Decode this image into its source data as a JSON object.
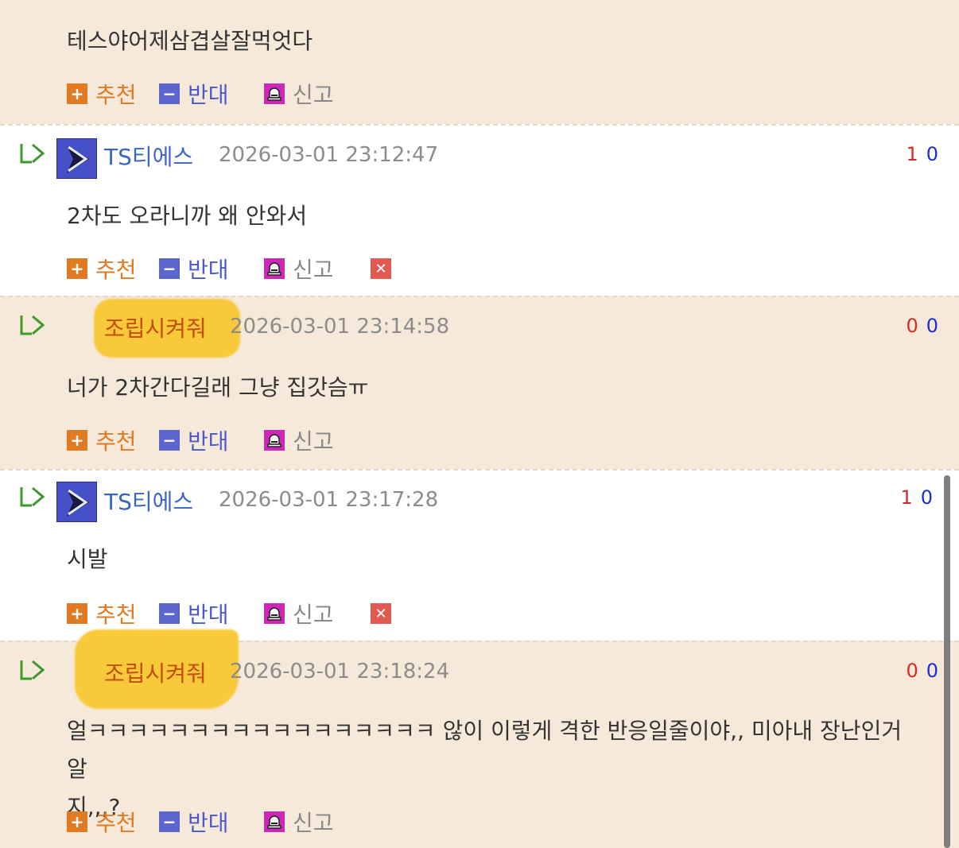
{
  "top_comment": {
    "content": "테스야어제삼겹살잘먹엇다",
    "actions": {
      "recommend": "추천",
      "oppose": "반대",
      "report": "신고"
    }
  },
  "comments": [
    {
      "nickname": "TS티에스",
      "timestamp": "2026-03-01 23:12:47",
      "votes_up": "1",
      "votes_down": "0",
      "content": "2차도 오라니까 왜 안와서",
      "actions": {
        "recommend": "추천",
        "oppose": "반대",
        "report": "신고"
      }
    },
    {
      "nickname": "조립시켜줘",
      "timestamp": "2026-03-01 23:14:58",
      "votes_up": "0",
      "votes_down": "0",
      "content": "너가 2차간다길래 그냥 집갓슴ㅠ",
      "actions": {
        "recommend": "추천",
        "oppose": "반대",
        "report": "신고"
      }
    },
    {
      "nickname": "TS티에스",
      "timestamp": "2026-03-01 23:17:28",
      "votes_up": "1",
      "votes_down": "0",
      "content": "시발",
      "actions": {
        "recommend": "추천",
        "oppose": "반대",
        "report": "신고"
      }
    },
    {
      "nickname": "조립시켜줘",
      "timestamp": "2026-03-01 23:18:24",
      "votes_up": "0",
      "votes_down": "0",
      "content": "얼ㅋㅋㅋㅋㅋㅋㅋㅋㅋㅋㅋㅋㅋㅋㅋㅋㅋ 않이 이렇게 격한 반응일줄이야,, 미아내 장난인거 알\n지,,,?",
      "actions": {
        "recommend": "추천",
        "oppose": "반대",
        "report": "신고"
      }
    }
  ],
  "icons": {
    "reply": "reply-arrow-icon",
    "avatar": "play-arrow-avatar-icon",
    "recommend": "plus-icon",
    "oppose": "minus-icon",
    "report": "siren-icon",
    "delete": "close-icon"
  },
  "colors": {
    "bg_beige": "#f7e9d9",
    "nick_blue": "#3a64c8",
    "nick_orange": "#c44d0a",
    "highlight": "#f8c93a",
    "vote_up": "#d72a25",
    "vote_down": "#1e2fcf"
  }
}
